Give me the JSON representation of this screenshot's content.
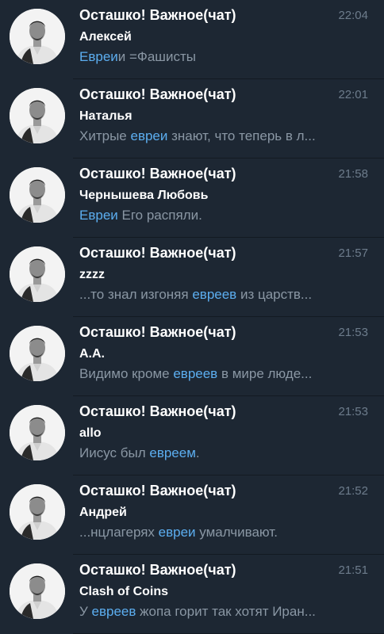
{
  "chats": [
    {
      "title": "Осташко! Важное(чат)",
      "time": "22:04",
      "sender": "Алексей",
      "preview": [
        {
          "text": "Евреи",
          "hl": true
        },
        {
          "text": "и =Фашисты",
          "hl": false
        }
      ]
    },
    {
      "title": "Осташко! Важное(чат)",
      "time": "22:01",
      "sender": "Наталья",
      "preview": [
        {
          "text": "Хитрые ",
          "hl": false
        },
        {
          "text": "евреи",
          "hl": true
        },
        {
          "text": " знают, что теперь в л...",
          "hl": false
        }
      ]
    },
    {
      "title": "Осташко! Важное(чат)",
      "time": "21:58",
      "sender": "Чернышева Любовь",
      "preview": [
        {
          "text": "Евреи",
          "hl": true
        },
        {
          "text": " Его распяли.",
          "hl": false
        }
      ]
    },
    {
      "title": "Осташко! Важное(чат)",
      "time": "21:57",
      "sender": "zzzz",
      "preview": [
        {
          "text": "...то знал изгоняя ",
          "hl": false
        },
        {
          "text": "евреев",
          "hl": true
        },
        {
          "text": " из царств...",
          "hl": false
        }
      ]
    },
    {
      "title": "Осташко! Важное(чат)",
      "time": "21:53",
      "sender": "А.А.",
      "preview": [
        {
          "text": "Видимо кроме ",
          "hl": false
        },
        {
          "text": "евреев",
          "hl": true
        },
        {
          "text": " в мире люде...",
          "hl": false
        }
      ]
    },
    {
      "title": "Осташко! Важное(чат)",
      "time": "21:53",
      "sender": "allo",
      "preview": [
        {
          "text": "Иисус был ",
          "hl": false
        },
        {
          "text": "евреем",
          "hl": true
        },
        {
          "text": ".",
          "hl": false
        }
      ]
    },
    {
      "title": "Осташко! Важное(чат)",
      "time": "21:52",
      "sender": "Андрей",
      "preview": [
        {
          "text": "...нцлагерях ",
          "hl": false
        },
        {
          "text": "евреи",
          "hl": true
        },
        {
          "text": " умалчивают.",
          "hl": false
        }
      ]
    },
    {
      "title": "Осташко! Важное(чат)",
      "time": "21:51",
      "sender": "Clash of Coins",
      "preview": [
        {
          "text": "У ",
          "hl": false
        },
        {
          "text": "евреев",
          "hl": true
        },
        {
          "text": " жопа горит так хотят Иран...",
          "hl": false
        }
      ]
    }
  ],
  "colors": {
    "background": "#1d2733",
    "highlight": "#5caef0",
    "muted": "#8a97a4",
    "time": "#6d7c8c"
  }
}
